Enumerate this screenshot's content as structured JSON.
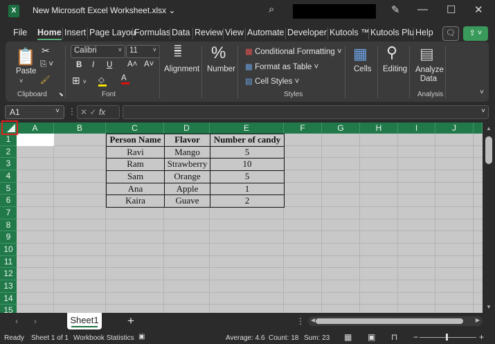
{
  "titlebar": {
    "app_icon": "X",
    "title": "New Microsoft Excel Worksheet.xlsx ⌄",
    "search_icon": "search-icon",
    "pen_icon": "pen-icon",
    "minimize": "—",
    "maximize": "☐",
    "close": "✕"
  },
  "tabs": [
    "File",
    "Home",
    "Insert",
    "Page Layou",
    "Formulas",
    "Data",
    "Review",
    "View",
    "Automate",
    "Developer",
    "Kutools ™",
    "Kutools Plu",
    "Help"
  ],
  "active_tab": "Home",
  "ribbon": {
    "clipboard": {
      "paste": "Paste",
      "label": "Clipboard"
    },
    "font": {
      "name": "Calibri",
      "size": "11",
      "bold": "B",
      "italic": "I",
      "underline": "U",
      "grow": "A˄",
      "shrink": "A˅",
      "label": "Font"
    },
    "alignment": {
      "label": "Alignment"
    },
    "number": {
      "label": "Number",
      "icon": "%"
    },
    "styles": {
      "conditional": "Conditional Formatting ˅",
      "table": "Format as Table ˅",
      "cell_styles": "Cell Styles ˅",
      "label": "Styles"
    },
    "cells": {
      "label": "Cells"
    },
    "editing": {
      "label": "Editing"
    },
    "analysis": {
      "button": "Analyze Data",
      "label": "Analysis"
    },
    "colors": {
      "highlight": "#f5e400",
      "font_color": "#e01010"
    }
  },
  "formula_bar": {
    "name_box": "A1",
    "fx": "fx",
    "cancel": "✕",
    "enter": "✓",
    "value": ""
  },
  "columns": [
    "A",
    "B",
    "C",
    "D",
    "E",
    "F",
    "G",
    "H",
    "I",
    "J"
  ],
  "rows": [
    "1",
    "2",
    "3",
    "4",
    "5",
    "6",
    "7",
    "8",
    "9",
    "10",
    "11",
    "12",
    "13",
    "14",
    "15"
  ],
  "table": {
    "headers": [
      "Person Name",
      "Flavor",
      "Number of candy"
    ],
    "rows": [
      [
        "Ravi",
        "Mango",
        "5"
      ],
      [
        "Ram",
        "Strawberry",
        "10"
      ],
      [
        "Sam",
        "Orange",
        "5"
      ],
      [
        "Ana",
        "Apple",
        "1"
      ],
      [
        "Kaira",
        "Guave",
        "2"
      ]
    ]
  },
  "sheets": {
    "tabs": [
      "Sheet1"
    ],
    "add": "+"
  },
  "status": {
    "ready": "Ready",
    "sheet": "Sheet 1 of 1",
    "stats": "Workbook Statistics",
    "average": "Average: 4.6",
    "count": "Count: 18",
    "sum": "Sum: 23"
  },
  "accent": "#21794a"
}
